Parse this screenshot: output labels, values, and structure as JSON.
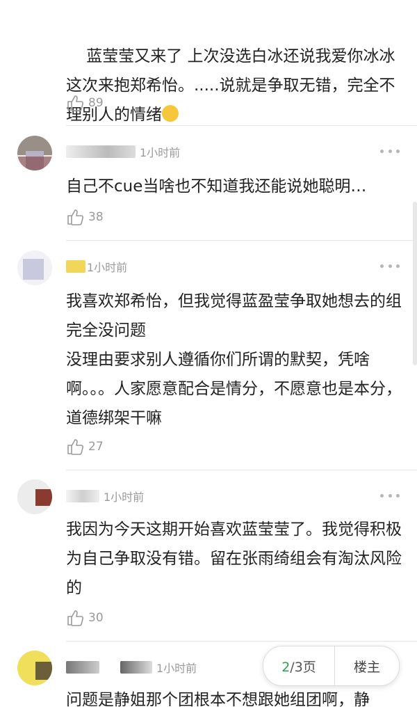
{
  "comments": [
    {
      "text": "蓝莹莹又来了 上次没选白冰还说我爱你冰冰这次来抱郑希怡。.....说就是争取无错，完全不理别人的情绪",
      "emoji": "😮",
      "likes": "89"
    },
    {
      "time": "1小时前",
      "text": "自己不cue当啥也不知道我还能说她聪明…",
      "likes": "38"
    },
    {
      "time": "1小时前",
      "text": "我喜欢郑希怡，但我觉得蓝盈莹争取她想去的组完全没问题\n没理由要求别人遵循你们所谓的默契，凭啥啊。。。人家愿意配合是情分，不愿意也是本分，道德绑架干嘛",
      "likes": "27"
    },
    {
      "time": "1小时前",
      "text": "我因为今天这期开始喜欢蓝莹莹了。我觉得积极为自己争取没有错。留在张雨绮组会有淘汰风险的",
      "likes": "30"
    },
    {
      "time": "1小时前",
      "text": "问题是静姐那个团根本不想跟她组团啊，静"
    }
  ],
  "pager": {
    "current": "2",
    "total_label": "/3页",
    "owner_label": "楼主"
  },
  "icons": {
    "like": "thumbs-up-icon",
    "more": "more-dots-icon"
  },
  "colors": {
    "accent": "#2ba245",
    "meta": "#9a9a9a"
  }
}
